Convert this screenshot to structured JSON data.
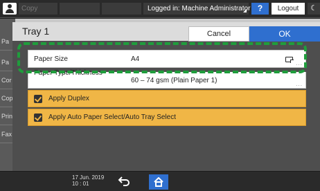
{
  "topbar": {
    "app_name": "Copy",
    "login_text": "Logged in: Machine Administrator",
    "help_label": "?",
    "logout_label": "Logout",
    "moon_label": "☾"
  },
  "background": {
    "side_items": [
      "Pa",
      "Pa",
      "Cor",
      "Cop",
      "Prin",
      "Fax"
    ]
  },
  "dialog": {
    "title": "Tray 1",
    "cancel_label": "Cancel",
    "ok_label": "OK",
    "paper_size": {
      "label": "Paper Size",
      "value": "A4",
      "dots": "..."
    },
    "paper_type": {
      "label": "Paper Type/Thickness",
      "value": "60 – 74 gsm (Plain Paper 1)",
      "dots": "..."
    },
    "options": [
      {
        "label": "Apply Duplex",
        "checked": true
      },
      {
        "label": "Apply Auto Paper Select/Auto Tray Select",
        "checked": true
      }
    ]
  },
  "bottombar": {
    "date": "17 Jun. 2019",
    "time": "10 : 01"
  },
  "colors": {
    "accent": "#2f6fcf",
    "option_bg": "#f0b646",
    "highlight": "#1f9d3c"
  }
}
